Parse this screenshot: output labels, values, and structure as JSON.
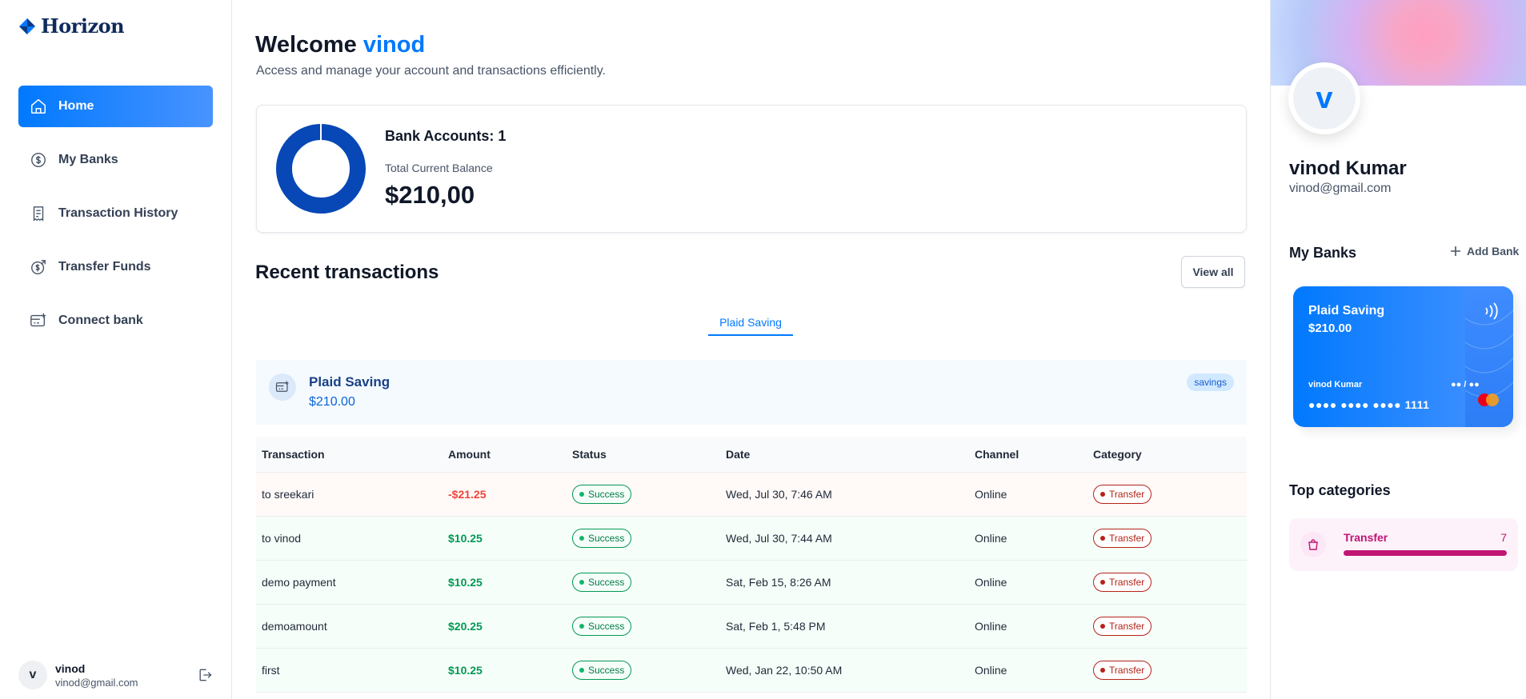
{
  "app": {
    "brand": "Horizon"
  },
  "sidebar": {
    "items": [
      {
        "label": "Home",
        "icon": "home-icon",
        "active": true
      },
      {
        "label": "My Banks",
        "icon": "dollar-circle-icon",
        "active": false
      },
      {
        "label": "Transaction History",
        "icon": "receipt-icon",
        "active": false
      },
      {
        "label": "Transfer Funds",
        "icon": "money-send-icon",
        "active": false
      },
      {
        "label": "Connect bank",
        "icon": "card-add-icon",
        "active": false
      }
    ],
    "user": {
      "initial": "v",
      "name": "vinod",
      "email": "vinod@gmail.com"
    }
  },
  "header": {
    "welcome_prefix": "Welcome",
    "welcome_name": "vinod",
    "subtitle": "Access and manage your account and transactions efficiently."
  },
  "balance": {
    "bank_accounts_label": "Bank Accounts: 1",
    "total_label": "Total Current Balance",
    "total_value": "$210,00",
    "colors": {
      "ring": "#0747b6"
    }
  },
  "recent": {
    "title": "Recent transactions",
    "view_all": "View all",
    "tab": "Plaid Saving",
    "account": {
      "name": "Plaid Saving",
      "balance": "$210.00",
      "type": "savings"
    },
    "columns": [
      "Transaction",
      "Amount",
      "Status",
      "Date",
      "Channel",
      "Category"
    ],
    "rows": [
      {
        "name": "to sreekari",
        "amount": "-$21.25",
        "kind": "debit",
        "status": "Success",
        "date": "Wed, Jul 30, 7:46 AM",
        "channel": "Online",
        "category": "Transfer"
      },
      {
        "name": "to vinod",
        "amount": "$10.25",
        "kind": "credit",
        "status": "Success",
        "date": "Wed, Jul 30, 7:44 AM",
        "channel": "Online",
        "category": "Transfer"
      },
      {
        "name": "demo payment",
        "amount": "$10.25",
        "kind": "credit",
        "status": "Success",
        "date": "Sat, Feb 15, 8:26 AM",
        "channel": "Online",
        "category": "Transfer"
      },
      {
        "name": "demoamount",
        "amount": "$20.25",
        "kind": "credit",
        "status": "Success",
        "date": "Sat, Feb 1, 5:48 PM",
        "channel": "Online",
        "category": "Transfer"
      },
      {
        "name": "first",
        "amount": "$10.25",
        "kind": "credit",
        "status": "Success",
        "date": "Wed, Jan 22, 10:50 AM",
        "channel": "Online",
        "category": "Transfer"
      }
    ]
  },
  "profile": {
    "initial": "v",
    "full_name": "vinod Kumar",
    "email": "vinod@gmail.com"
  },
  "mybanks": {
    "title": "My Banks",
    "add_label": "Add Bank",
    "card": {
      "bank_name": "Plaid Saving",
      "balance": "$210.00",
      "holder": "vinod Kumar",
      "expiry": "●● / ●●",
      "number": "●●●● ●●●● ●●●● 1111"
    }
  },
  "categories": {
    "title": "Top categories",
    "items": [
      {
        "name": "Transfer",
        "count": "7",
        "progress": 1.0
      }
    ]
  }
}
